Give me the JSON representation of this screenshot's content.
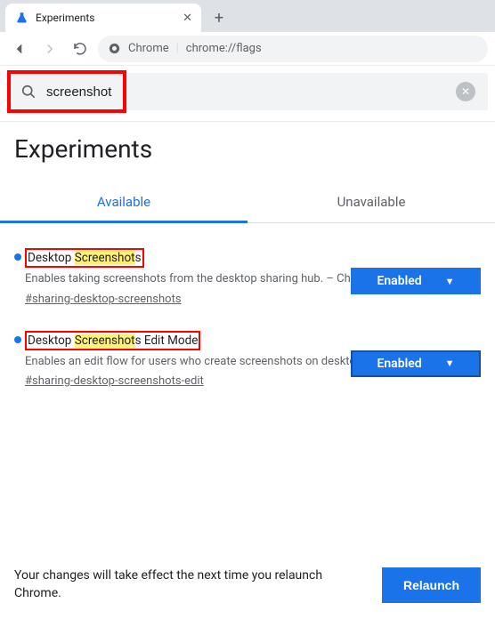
{
  "browser": {
    "tab_title": "Experiments",
    "omnibox_label": "Chrome",
    "url": "chrome://flags"
  },
  "search": {
    "query": "screenshot"
  },
  "page_title": "Experiments",
  "tabs": {
    "available": "Available",
    "unavailable": "Unavailable"
  },
  "flags": [
    {
      "title_pre": "Desktop ",
      "title_hl": "Screenshot",
      "title_post": "s",
      "title_after_box": "",
      "desc": "Enables taking screenshots from the desktop sharing hub. – ChromeOS, Fuchsia, Lacros",
      "tag": "#sharing-desktop-screenshots",
      "select_value": "Enabled",
      "select_outlined": false
    },
    {
      "title_pre": "Desktop ",
      "title_hl": "Screenshot",
      "title_post": "s Edit Mode",
      "title_after_box": "",
      "desc": "Enables an edit flow for users who create screenshots on desktop – ChromeOS, Fuchsia, Lacros",
      "tag": "#sharing-desktop-screenshots-edit",
      "select_value": "Enabled",
      "select_outlined": true
    }
  ],
  "footer": {
    "message": "Your changes will take effect the next time you relaunch Chrome.",
    "button": "Relaunch"
  }
}
